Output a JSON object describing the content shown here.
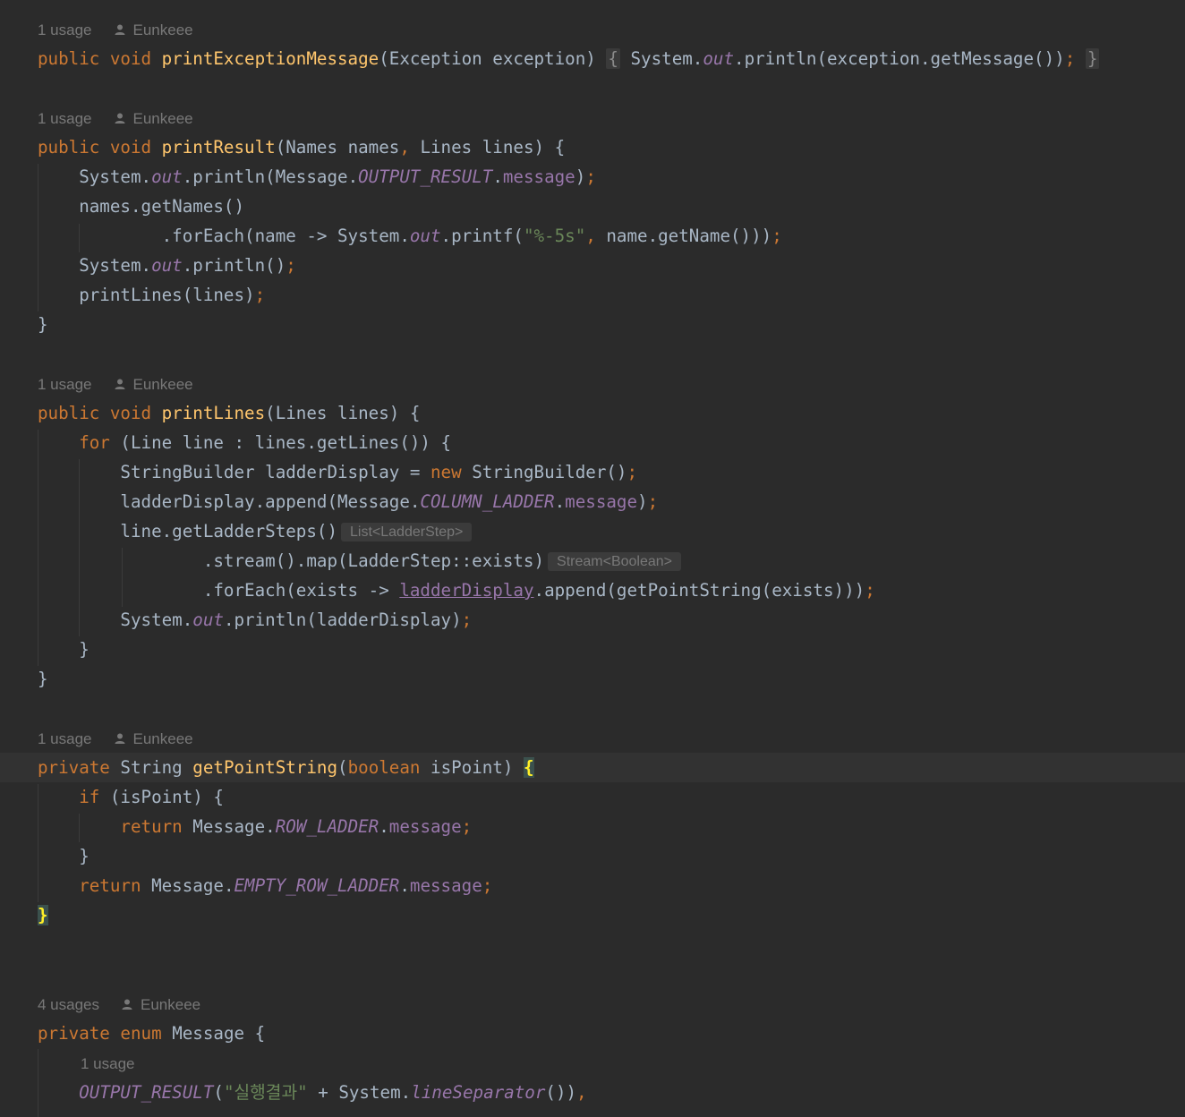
{
  "author": "Eunkeee",
  "colors": {
    "background": "#2b2b2b",
    "keyword": "#cc7832",
    "method": "#ffc66d",
    "static": "#9876aa",
    "string": "#6a8759",
    "plain": "#a9b7c6",
    "hint": "#787878"
  },
  "usages": {
    "printExceptionMessage": "1 usage",
    "printResult": "1 usage",
    "printLines": "1 usage",
    "getPointString": "1 usage",
    "Message": "4 usages",
    "OUTPUT_RESULT": "1 usage"
  },
  "type_hints": {
    "getLadderSteps": "List<LadderStep>",
    "stream_map": "Stream<Boolean>"
  },
  "code_lines": [
    "public void printExceptionMessage(Exception exception) { System.out.println(exception.getMessage()); }",
    "public void printResult(Names names, Lines lines) {",
    "    System.out.println(Message.OUTPUT_RESULT.message);",
    "    names.getNames()",
    "            .forEach(name -> System.out.printf(\"%-5s\", name.getName()));",
    "    System.out.println();",
    "    printLines(lines);",
    "}",
    "public void printLines(Lines lines) {",
    "    for (Line line : lines.getLines()) {",
    "        StringBuilder ladderDisplay = new StringBuilder();",
    "        ladderDisplay.append(Message.COLUMN_LADDER.message);",
    "        line.getLadderSteps()",
    "                .stream().map(LadderStep::exists)",
    "                .forEach(exists -> ladderDisplay.append(getPointString(exists)));",
    "        System.out.println(ladderDisplay);",
    "    }",
    "}",
    "private String getPointString(boolean isPoint) {",
    "    if (isPoint) {",
    "        return Message.ROW_LADDER.message;",
    "    }",
    "    return Message.EMPTY_ROW_LADDER.message;",
    "}",
    "private enum Message {",
    "    OUTPUT_RESULT(\"실행결과\" + System.lineSeparator()),"
  ]
}
